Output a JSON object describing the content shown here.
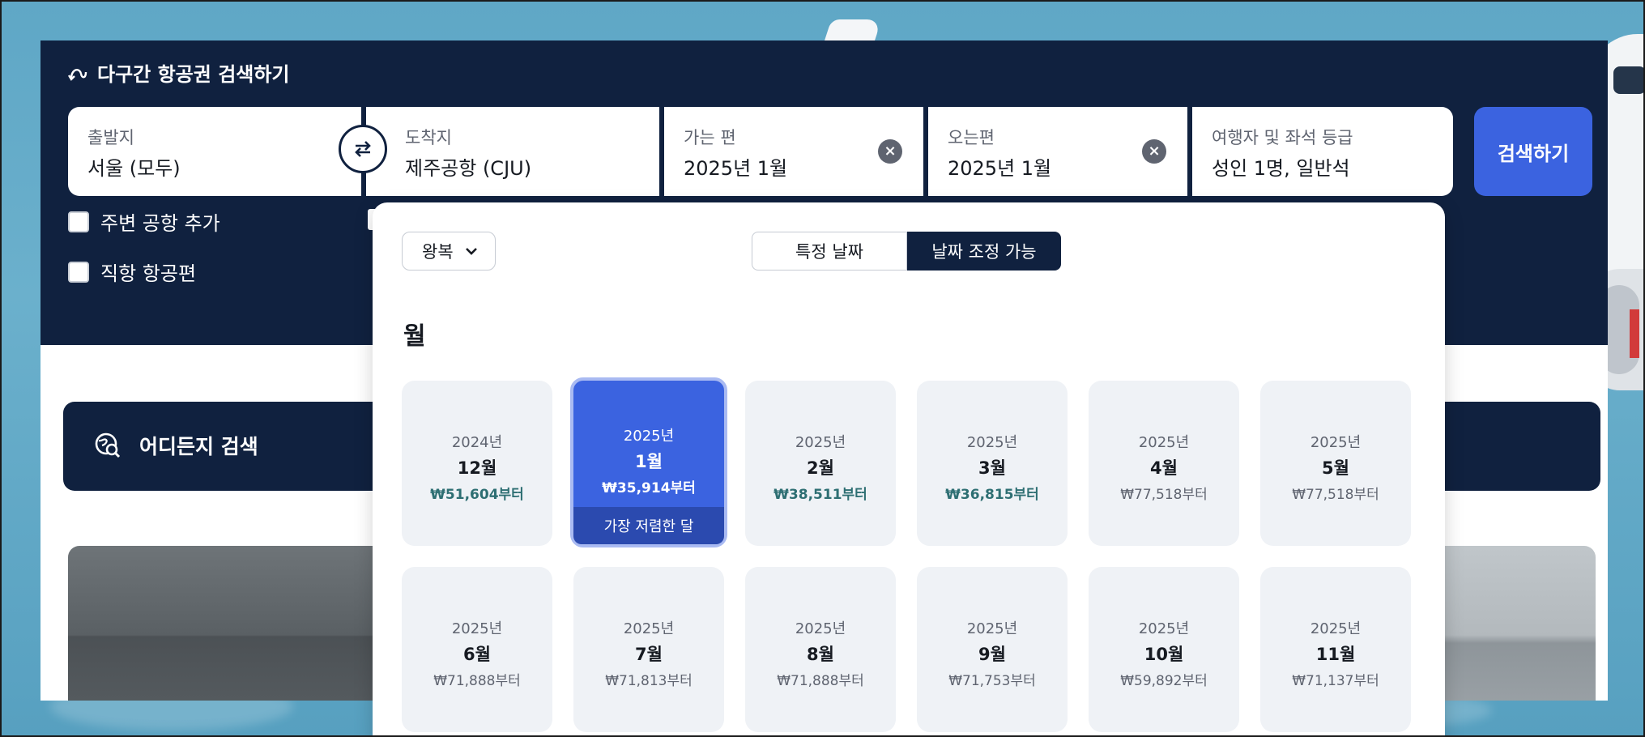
{
  "header": {
    "title": "다구간 항공권 검색하기"
  },
  "fields": {
    "origin": {
      "label": "출발지",
      "value": "서울 (모두)"
    },
    "destination": {
      "label": "도착지",
      "value": "제주공항 (CJU)"
    },
    "depart": {
      "label": "가는 편",
      "value": "2025년 1월"
    },
    "return": {
      "label": "오는편",
      "value": "2025년 1월"
    },
    "travelers": {
      "label": "여행자 및 좌석 등급",
      "value": "성인 1명, 일반석"
    }
  },
  "search_button": "검색하기",
  "options": {
    "nearby_airports": {
      "label": "주변 공항 추가",
      "checked": false
    },
    "direct_flights": {
      "label": "직항 항공편",
      "checked": false
    }
  },
  "anywhere": {
    "label": "어디든지 검색"
  },
  "popover": {
    "trip_type": "왕복",
    "segments": [
      "특정 날짜",
      "날짜 조정 가능"
    ],
    "active_segment": "날짜 조정 가능",
    "section_title": "월",
    "cheapest_tag": "가장 저렴한 달",
    "months": [
      {
        "year": "2024년",
        "month": "12월",
        "price": "₩51,604부터",
        "highlight": true,
        "selected": false
      },
      {
        "year": "2025년",
        "month": "1월",
        "price": "₩35,914부터",
        "highlight": true,
        "selected": true
      },
      {
        "year": "2025년",
        "month": "2월",
        "price": "₩38,511부터",
        "highlight": true,
        "selected": false
      },
      {
        "year": "2025년",
        "month": "3월",
        "price": "₩36,815부터",
        "highlight": true,
        "selected": false
      },
      {
        "year": "2025년",
        "month": "4월",
        "price": "₩77,518부터",
        "highlight": false,
        "selected": false
      },
      {
        "year": "2025년",
        "month": "5월",
        "price": "₩77,518부터",
        "highlight": false,
        "selected": false
      },
      {
        "year": "2025년",
        "month": "6월",
        "price": "₩71,888부터",
        "highlight": false,
        "selected": false
      },
      {
        "year": "2025년",
        "month": "7월",
        "price": "₩71,813부터",
        "highlight": false,
        "selected": false
      },
      {
        "year": "2025년",
        "month": "8월",
        "price": "₩71,888부터",
        "highlight": false,
        "selected": false
      },
      {
        "year": "2025년",
        "month": "9월",
        "price": "₩71,753부터",
        "highlight": false,
        "selected": false
      },
      {
        "year": "2025년",
        "month": "10월",
        "price": "₩59,892부터",
        "highlight": false,
        "selected": false
      },
      {
        "year": "2025년",
        "month": "11월",
        "price": "₩71,137부터",
        "highlight": false,
        "selected": false
      }
    ]
  },
  "colors": {
    "navy": "#10213f",
    "accent": "#3b63e0",
    "price_green": "#2e6f73"
  },
  "icons": [
    "multi-city-icon",
    "swap-icon",
    "clear-icon",
    "checkbox-icon",
    "globe-search-icon",
    "chevron-down-icon"
  ]
}
